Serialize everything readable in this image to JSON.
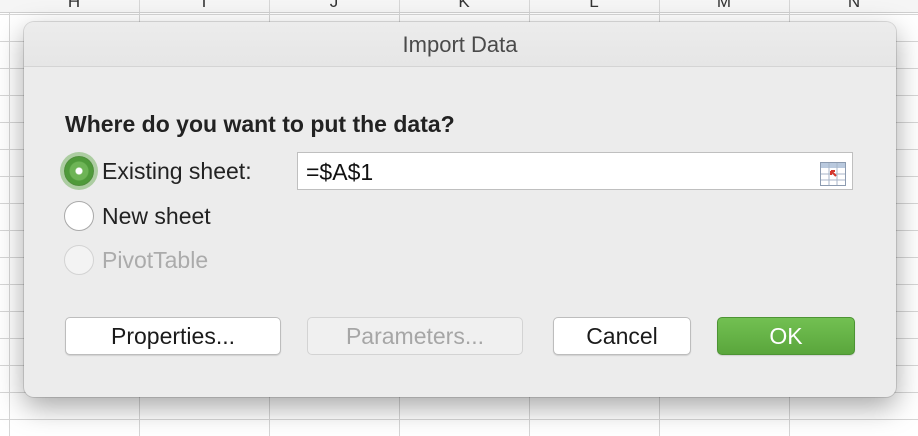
{
  "spreadsheet": {
    "column_headers": [
      "H",
      "I",
      "J",
      "K",
      "L",
      "M",
      "N"
    ]
  },
  "dialog": {
    "title": "Import Data",
    "question": "Where do you want to put the data?",
    "options": {
      "existing_sheet": {
        "label": "Existing sheet:",
        "selected": true
      },
      "new_sheet": {
        "label": "New sheet",
        "selected": false
      },
      "pivot_table": {
        "label": "PivotTable",
        "enabled": false
      }
    },
    "reference": {
      "value": "=$A$1",
      "picker_icon": "range-picker-icon"
    },
    "buttons": {
      "properties": "Properties...",
      "parameters": "Parameters...",
      "cancel": "Cancel",
      "ok": "OK"
    },
    "colors": {
      "accent": "#5aa63c",
      "dialog_bg": "#ececec"
    }
  }
}
